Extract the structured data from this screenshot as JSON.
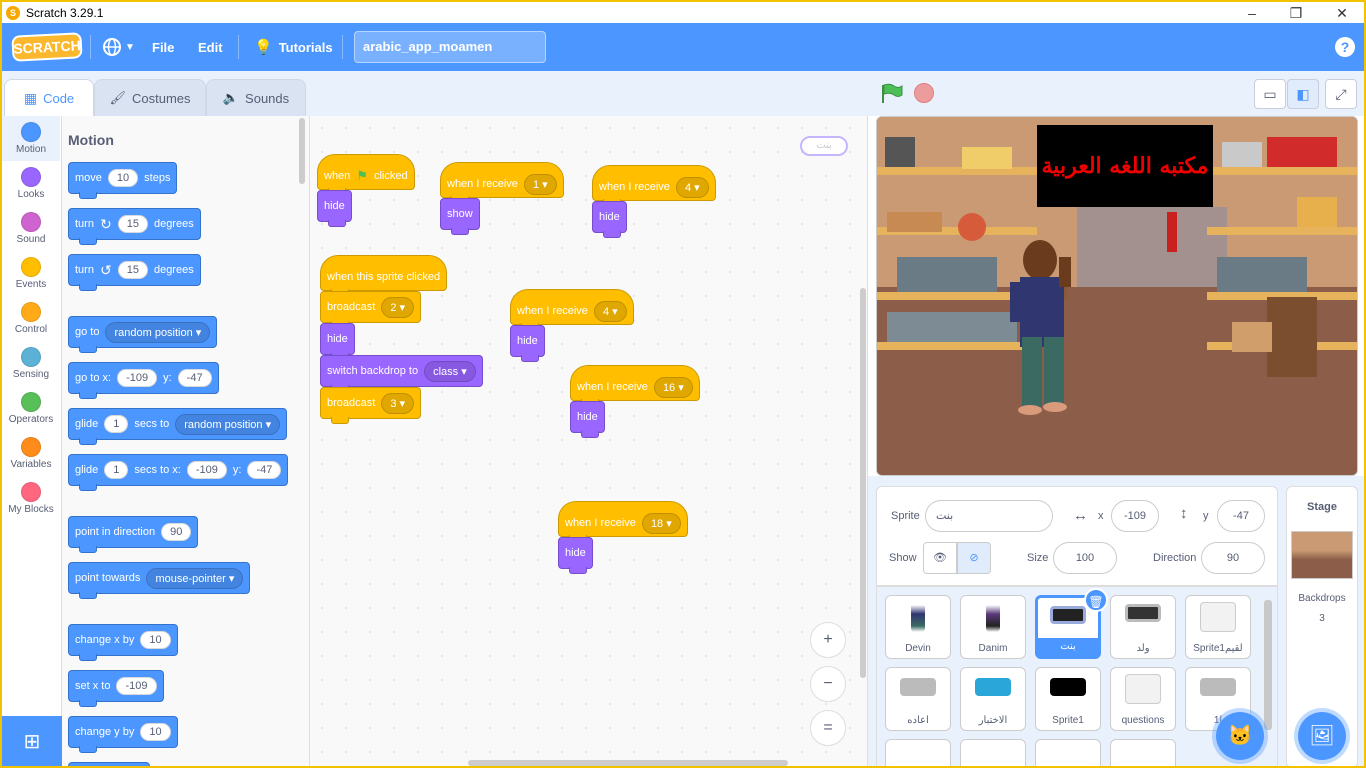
{
  "window": {
    "title": "Scratch 3.29.1",
    "min": "–",
    "max": "❐",
    "close": "✕"
  },
  "menu": {
    "logo": "SCRATCH",
    "language_icon": "globe-icon",
    "file": "File",
    "edit": "Edit",
    "tutorials": "Tutorials",
    "project_name": "arabic_app_moamen",
    "help": "?"
  },
  "tabs": [
    {
      "label": "Code",
      "active": true
    },
    {
      "label": "Costumes"
    },
    {
      "label": "Sounds"
    }
  ],
  "categories": [
    {
      "label": "Motion",
      "color": "#4c97ff"
    },
    {
      "label": "Looks",
      "color": "#9966ff"
    },
    {
      "label": "Sound",
      "color": "#cf63cf"
    },
    {
      "label": "Events",
      "color": "#ffbf00"
    },
    {
      "label": "Control",
      "color": "#ffab19"
    },
    {
      "label": "Sensing",
      "color": "#5cb1d6"
    },
    {
      "label": "Operators",
      "color": "#59c059"
    },
    {
      "label": "Variables",
      "color": "#ff8c1a"
    },
    {
      "label": "My Blocks",
      "color": "#ff6680"
    }
  ],
  "palette": {
    "heading": "Motion",
    "move": {
      "a": "move",
      "v": "10",
      "b": "steps"
    },
    "turn_right": {
      "a": "turn",
      "v": "15",
      "b": "degrees"
    },
    "turn_left": {
      "a": "turn",
      "v": "15",
      "b": "degrees"
    },
    "goto": {
      "a": "go to",
      "v": "random position"
    },
    "gotoxy": {
      "a": "go to x:",
      "x": "-109",
      "b": "y:",
      "y": "-47"
    },
    "glide": {
      "a": "glide",
      "v": "1",
      "b": "secs to",
      "t": "random position"
    },
    "glidexy": {
      "a": "glide",
      "v": "1",
      "b": "secs to x:",
      "x": "-109",
      "c": "y:",
      "y": "-47"
    },
    "point_dir": {
      "a": "point in direction",
      "v": "90"
    },
    "point_towards": {
      "a": "point towards",
      "v": "mouse-pointer"
    },
    "change_x": {
      "a": "change x by",
      "v": "10"
    },
    "set_x": {
      "a": "set x to",
      "v": "-109"
    },
    "change_y": {
      "a": "change y by",
      "v": "10"
    }
  },
  "scripts": {
    "s1": {
      "hat_a": "when",
      "hat_b": "clicked",
      "b1": "hide"
    },
    "s2": {
      "hat": "when I receive",
      "msg": "1",
      "b1": "show"
    },
    "s3": {
      "hat": "when I receive",
      "msg": "4",
      "b1": "hide"
    },
    "s4": {
      "hat": "when this sprite clicked",
      "b1": "broadcast",
      "b1v": "2",
      "b2": "hide",
      "b3": "switch backdrop to",
      "b3v": "class",
      "b4": "broadcast",
      "b4v": "3"
    },
    "s5": {
      "hat": "when I receive",
      "msg": "4",
      "b1": "hide"
    },
    "s6": {
      "hat": "when I receive",
      "msg": "16",
      "b1": "hide"
    },
    "s7": {
      "hat": "when I receive",
      "msg": "18",
      "b1": "hide"
    },
    "sprite_badge": "بنت"
  },
  "zoom": {
    "in": "+",
    "out": "−",
    "reset": "="
  },
  "stage": {
    "title": "مكتبه اللغه العربية"
  },
  "sprite_info": {
    "sprite_label": "Sprite",
    "sprite_name": "بنت",
    "x_label": "x",
    "x": "-109",
    "y_label": "y",
    "y": "-47",
    "show_label": "Show",
    "size_label": "Size",
    "size": "100",
    "direction_label": "Direction",
    "direction": "90"
  },
  "sprites": [
    {
      "name": "Devin"
    },
    {
      "name": "Danim"
    },
    {
      "name": "بنت",
      "selected": true
    },
    {
      "name": "ولد"
    },
    {
      "name": "Sprite1لقيم"
    },
    {
      "name": "اعاده"
    },
    {
      "name": "الاختبار"
    },
    {
      "name": "Sprite1"
    },
    {
      "name": "questions"
    },
    {
      "name": "1ا"
    }
  ],
  "stage_panel": {
    "title": "Stage",
    "backdrops_label": "Backdrops",
    "backdrops_count": "3"
  }
}
